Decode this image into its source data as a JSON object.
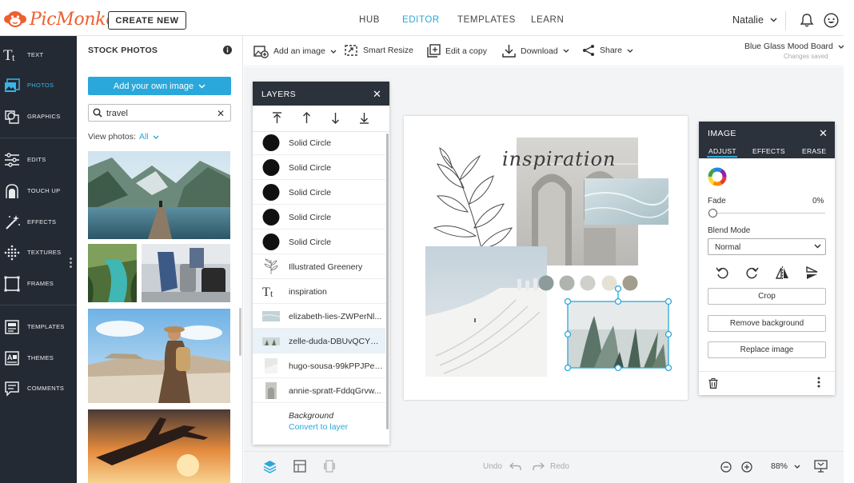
{
  "colors": {
    "brand_orange": "#ec5f2f",
    "accent_blue": "#2aa8db",
    "sidebar_bg": "#232a33",
    "panel_header_bg": "#2b323b",
    "swatches": [
      "#8e9b9b",
      "#b0b4ae",
      "#cfcfcb",
      "#e4e1d5",
      "#a39d8d"
    ]
  },
  "header": {
    "logo_text": "PicMonkey",
    "create_new": "CREATE NEW",
    "nav": [
      {
        "label": "HUB"
      },
      {
        "label": "EDITOR"
      },
      {
        "label": "TEMPLATES"
      },
      {
        "label": "LEARN"
      }
    ],
    "user_name": "Natalie"
  },
  "sidebar": {
    "items": [
      {
        "label": "TEXT",
        "icon": "text-icon"
      },
      {
        "label": "PHOTOS",
        "icon": "photos-icon"
      },
      {
        "label": "GRAPHICS",
        "icon": "graphics-icon"
      },
      {
        "label": "EDITS",
        "icon": "edits-icon"
      },
      {
        "label": "TOUCH UP",
        "icon": "touch-up-icon"
      },
      {
        "label": "EFFECTS",
        "icon": "effects-icon"
      },
      {
        "label": "TEXTURES",
        "icon": "textures-icon"
      },
      {
        "label": "FRAMES",
        "icon": "frames-icon"
      },
      {
        "label": "TEMPLATES",
        "icon": "templates-icon"
      },
      {
        "label": "THEMES",
        "icon": "themes-icon"
      },
      {
        "label": "COMMENTS",
        "icon": "comments-icon"
      }
    ]
  },
  "stock": {
    "title": "STOCK PHOTOS",
    "add_own": "Add your own image",
    "search_value": "travel",
    "view_label": "View photos:",
    "view_filter": "All"
  },
  "toolbar": {
    "add_image": "Add an image",
    "smart_resize": "Smart Resize",
    "edit_copy": "Edit a copy",
    "download": "Download",
    "share": "Share",
    "doc_title": "Blue Glass Mood Board",
    "doc_status": "Changes saved"
  },
  "layers": {
    "title": "LAYERS",
    "items": [
      {
        "label": "Solid Circle"
      },
      {
        "label": "Solid Circle"
      },
      {
        "label": "Solid Circle"
      },
      {
        "label": "Solid Circle"
      },
      {
        "label": "Solid Circle"
      },
      {
        "label": "Illustrated Greenery"
      },
      {
        "label": "inspiration"
      },
      {
        "label": "elizabeth-lies-ZWPerNl..."
      },
      {
        "label": "zelle-duda-DBUvQCYN..."
      },
      {
        "label": "hugo-sousa-99kPPJPed..."
      },
      {
        "label": "annie-spratt-FddqGrvw..."
      }
    ],
    "background_label": "Background",
    "convert_label": "Convert to layer"
  },
  "canvas": {
    "script_text": "inspiration"
  },
  "image_panel": {
    "title": "IMAGE",
    "tabs": [
      "ADJUST",
      "EFFECTS",
      "ERASE"
    ],
    "fade_label": "Fade",
    "fade_value": "0%",
    "blend_label": "Blend Mode",
    "blend_value": "Normal",
    "crop": "Crop",
    "remove_bg": "Remove background",
    "replace": "Replace image"
  },
  "bottom": {
    "undo": "Undo",
    "redo": "Redo",
    "zoom": "88%"
  }
}
